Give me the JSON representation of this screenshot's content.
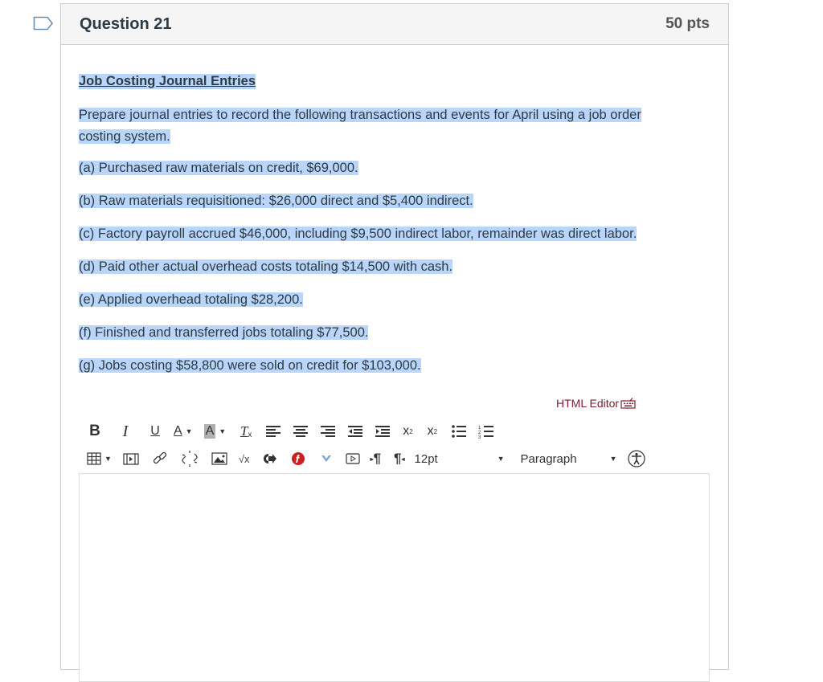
{
  "question": {
    "title": "Question 21",
    "points": "50 pts",
    "heading": "Job Costing Journal Entries",
    "intro_line1": "Prepare journal entries to record the following transactions and events for April using a job order",
    "intro_line2": "costing system.",
    "items": [
      "(a) Purchased raw materials on credit, $69,000.",
      "(b) Raw materials requisitioned: $26,000 direct and $5,400 indirect.",
      "(c) Factory payroll accrued $46,000, including $9,500 indirect labor, remainder was direct labor.",
      "(d) Paid other actual overhead costs totaling $14,500 with cash.",
      "(e) Applied overhead totaling $28,200.",
      "(f) Finished and transferred jobs totaling $77,500.",
      "(g) Jobs costing $58,800 were sold on credit for $103,000."
    ]
  },
  "editor": {
    "html_editor_label": "HTML Editor",
    "font_size": "12pt",
    "block_format": "Paragraph",
    "toolbar_row1": [
      "bold",
      "italic",
      "underline",
      "text-color",
      "background-color",
      "clear-formatting",
      "align-left",
      "align-center",
      "align-right",
      "outdent",
      "indent",
      "superscript",
      "subscript",
      "bullet-list",
      "numbered-list"
    ],
    "toolbar_row2": [
      "table",
      "media",
      "link",
      "unlink",
      "image",
      "equation",
      "embed",
      "flickr",
      "more-tools",
      "record-media",
      "ltr",
      "rtl"
    ],
    "labels": {
      "bold": "B",
      "italic": "I",
      "underline": "U",
      "text_color": "A",
      "bg_color": "A",
      "clear_format": "T",
      "sqrt": "√x",
      "superscript": "x",
      "subscript": "x"
    },
    "content": ""
  },
  "colors": {
    "selection": "#b9d5f9",
    "html_editor_link": "#7a1e2f",
    "header_bg": "#f5f5f5",
    "flickr_red": "#cc1f1f",
    "more_blue": "#7fa4d6"
  }
}
